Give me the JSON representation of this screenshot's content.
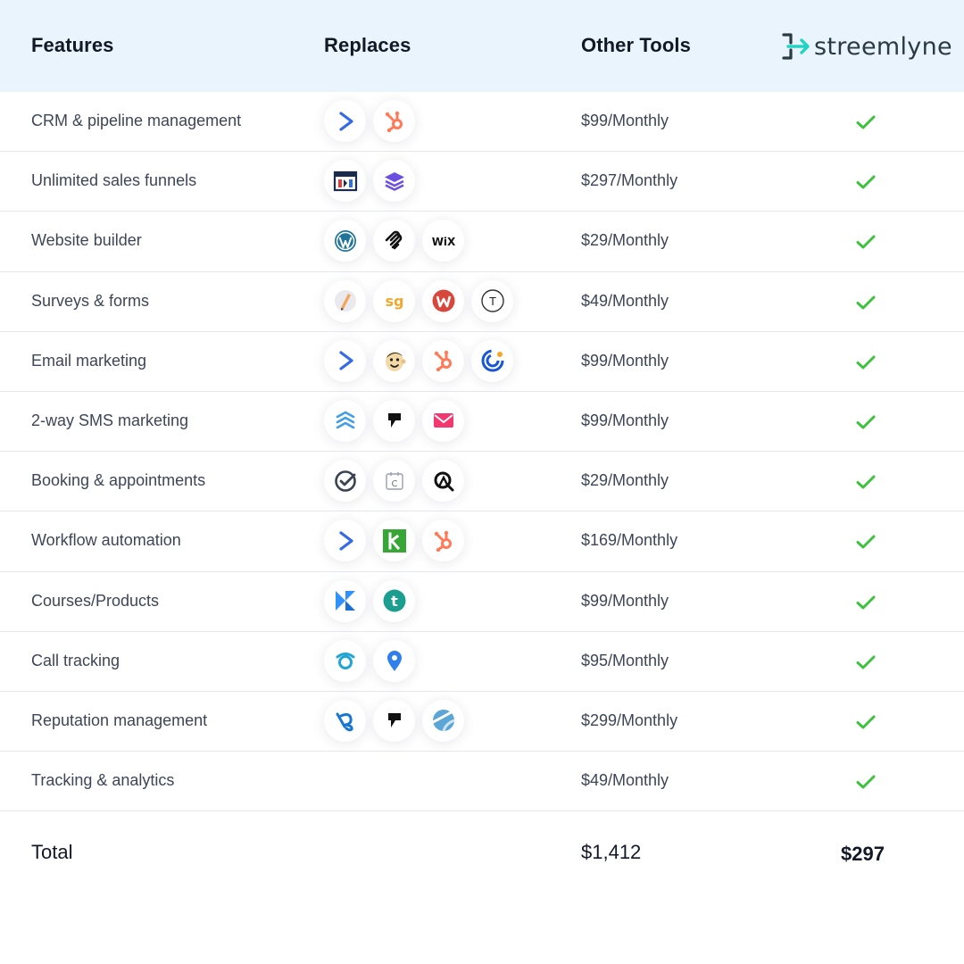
{
  "header": {
    "features": "Features",
    "replaces": "Replaces",
    "other_tools": "Other Tools",
    "brand": "streemlyne"
  },
  "colors": {
    "header_bg": "#e9f4fd",
    "check_green": "#3ec23e",
    "brand_accent": "#22d3c5"
  },
  "rows": [
    {
      "feature": "CRM & pipeline management",
      "icons": [
        "activecampaign-icon",
        "hubspot-icon"
      ],
      "price": "$99/Monthly",
      "included": true
    },
    {
      "feature": "Unlimited sales funnels",
      "icons": [
        "clickfunnels-icon",
        "layers-icon"
      ],
      "price": "$297/Monthly",
      "included": true
    },
    {
      "feature": "Website builder",
      "icons": [
        "wordpress-icon",
        "squarespace-icon",
        "wix-icon"
      ],
      "price": "$29/Monthly",
      "included": true
    },
    {
      "feature": "Surveys & forms",
      "icons": [
        "pen-icon",
        "surveygizmo-icon",
        "wufoo-icon",
        "typeform-icon"
      ],
      "price": "$49/Monthly",
      "included": true
    },
    {
      "feature": "Email marketing",
      "icons": [
        "activecampaign-icon",
        "mailchimp-icon",
        "hubspot-icon",
        "constantcontact-icon"
      ],
      "price": "$99/Monthly",
      "included": true
    },
    {
      "feature": "2-way SMS marketing",
      "icons": [
        "textmagic-icon",
        "podium-icon",
        "mail-icon"
      ],
      "price": "$99/Monthly",
      "included": true
    },
    {
      "feature": "Booking & appointments",
      "icons": [
        "check-circle-icon",
        "calendar-icon",
        "acuity-icon"
      ],
      "price": "$29/Monthly",
      "included": true
    },
    {
      "feature": "Workflow automation",
      "icons": [
        "activecampaign-icon",
        "keap-icon",
        "hubspot-icon"
      ],
      "price": "$169/Monthly",
      "included": true
    },
    {
      "feature": "Courses/Products",
      "icons": [
        "kajabi-icon",
        "teachable-icon"
      ],
      "price": "$99/Monthly",
      "included": true
    },
    {
      "feature": "Call tracking",
      "icons": [
        "callrail-icon",
        "location-pin-icon"
      ],
      "price": "$95/Monthly",
      "included": true
    },
    {
      "feature": "Reputation management",
      "icons": [
        "birdeye-icon",
        "podium-icon",
        "reputation-icon"
      ],
      "price": "$299/Monthly",
      "included": true
    },
    {
      "feature": "Tracking & analytics",
      "icons": [],
      "price": "$49/Monthly",
      "included": true
    }
  ],
  "total": {
    "label": "Total",
    "other": "$1,412",
    "ours": "$297"
  },
  "icon_text": {
    "surveygizmo": "sg",
    "wix": "WiX",
    "typeform": "T",
    "calendar": "C",
    "teachable": "t"
  }
}
